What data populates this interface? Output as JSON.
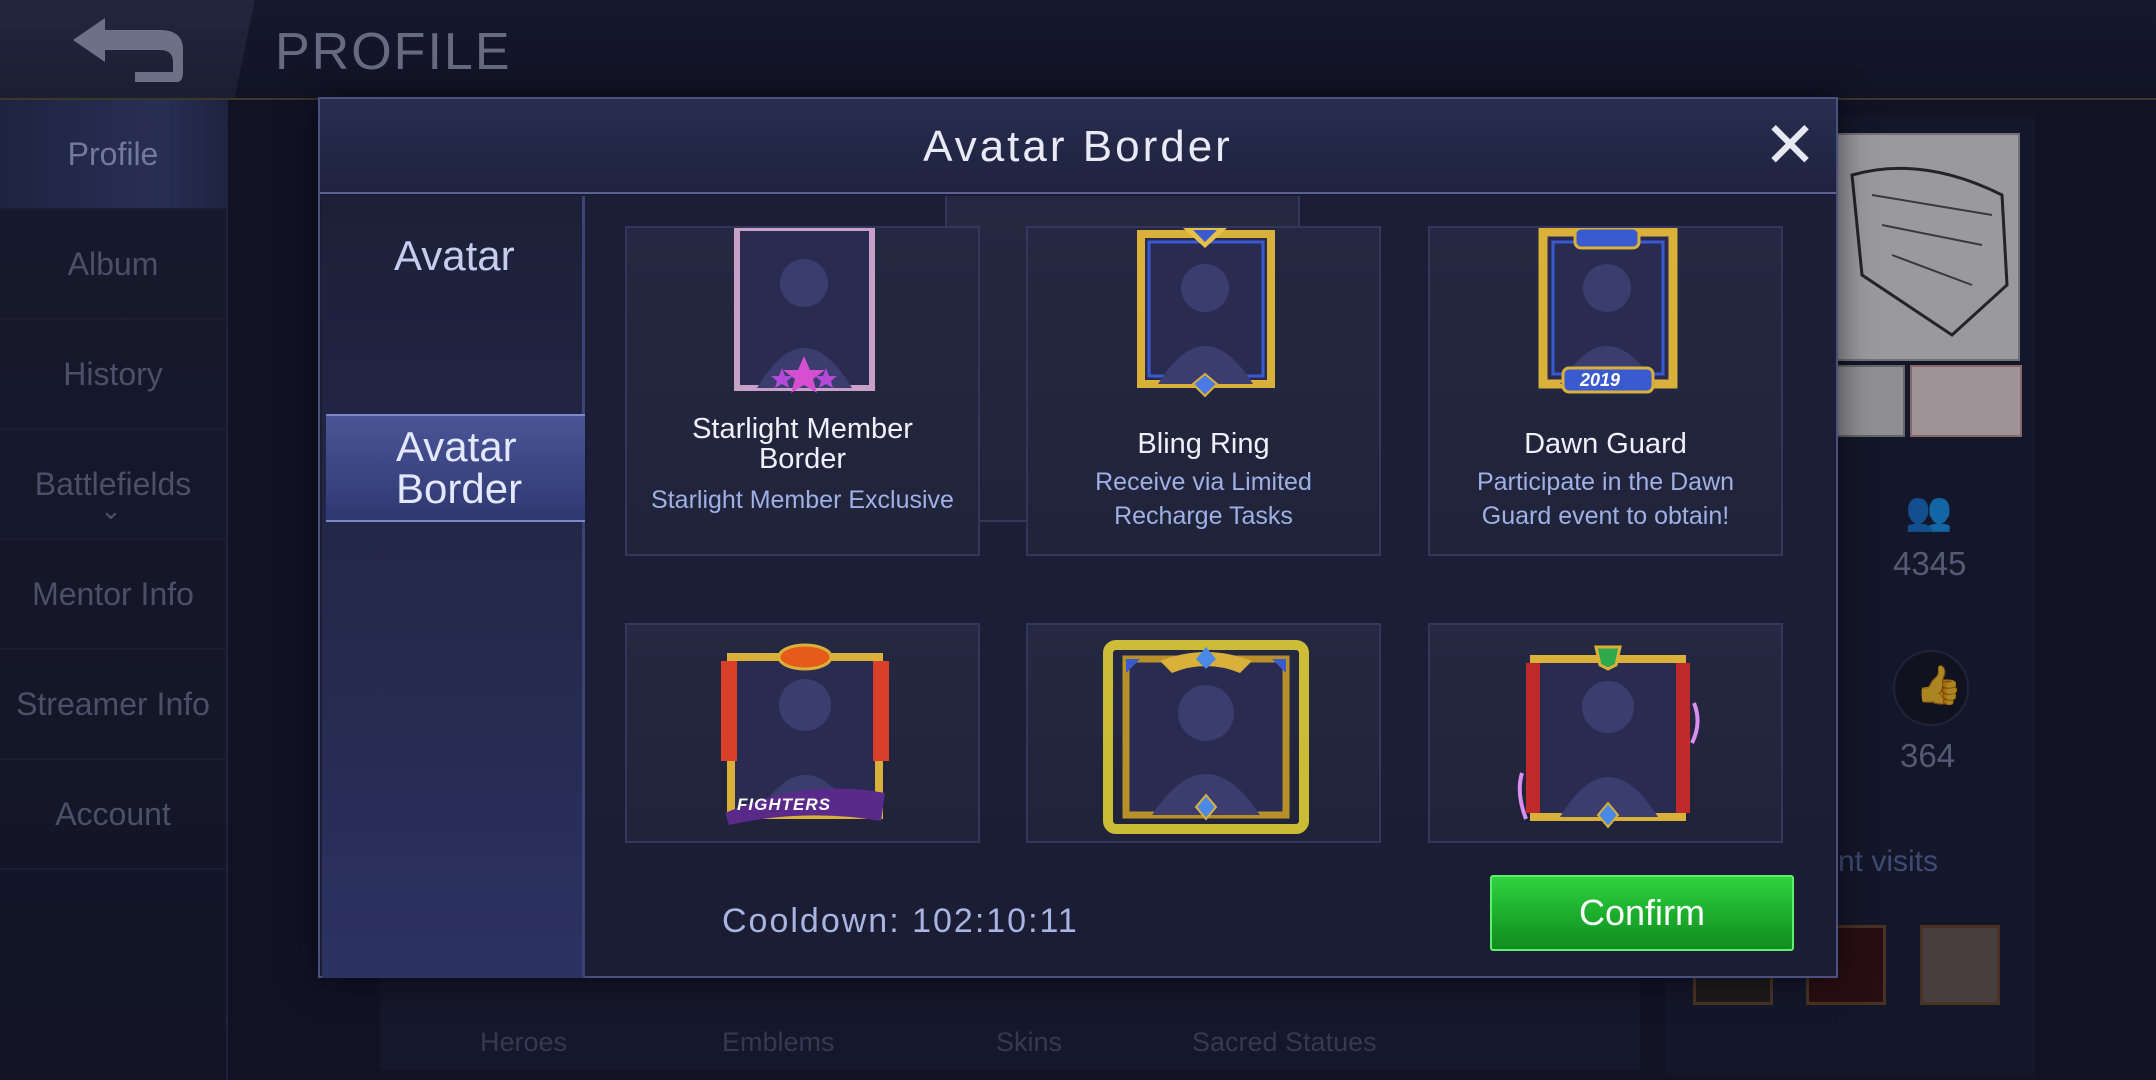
{
  "app": {
    "page_title": "PROFILE"
  },
  "side_nav": {
    "items": [
      {
        "label": "Profile"
      },
      {
        "label": "Album"
      },
      {
        "label": "History"
      },
      {
        "label": "Battlefields"
      },
      {
        "label": "Mentor Info"
      },
      {
        "label": "Streamer Info"
      },
      {
        "label": "Account"
      }
    ]
  },
  "background": {
    "tabs": [
      "Heroes",
      "Emblems",
      "Skins",
      "Sacred Statues"
    ],
    "stats": {
      "followers": "4345",
      "likes": "364"
    },
    "visits_label": "nt visits"
  },
  "modal": {
    "title": "Avatar Border",
    "tabs": [
      {
        "label": "Avatar"
      },
      {
        "label_line1": "Avatar",
        "label_line2": "Border"
      }
    ],
    "cards": [
      {
        "name_line1": "Starlight Member",
        "name_line2": "Border",
        "desc_line1": "Starlight Member Exclusive",
        "desc_line2": "",
        "frame_icon": "starlight-frame-icon"
      },
      {
        "name_line1": "Bling Ring",
        "name_line2": "",
        "desc_line1": "Receive via Limited",
        "desc_line2": "Recharge Tasks",
        "frame_icon": "bling-ring-frame-icon"
      },
      {
        "name_line1": "Dawn Guard",
        "name_line2": "",
        "desc_line1": "Participate in the Dawn",
        "desc_line2": "Guard event to obtain!",
        "frame_icon": "dawn-guard-frame-icon",
        "badge_text": "2019"
      },
      {
        "frame_icon": "kof-frame-icon",
        "logo_text": "FIGHTERS"
      },
      {
        "frame_icon": "gold-winged-frame-icon"
      },
      {
        "frame_icon": "red-gold-frame-icon"
      }
    ],
    "cooldown": "Cooldown: 102:10:11",
    "confirm_label": "Confirm"
  },
  "colors": {
    "accent_blue": "#4a5598",
    "confirm_green": "#1aa82a",
    "gold": "#d8b24a"
  }
}
